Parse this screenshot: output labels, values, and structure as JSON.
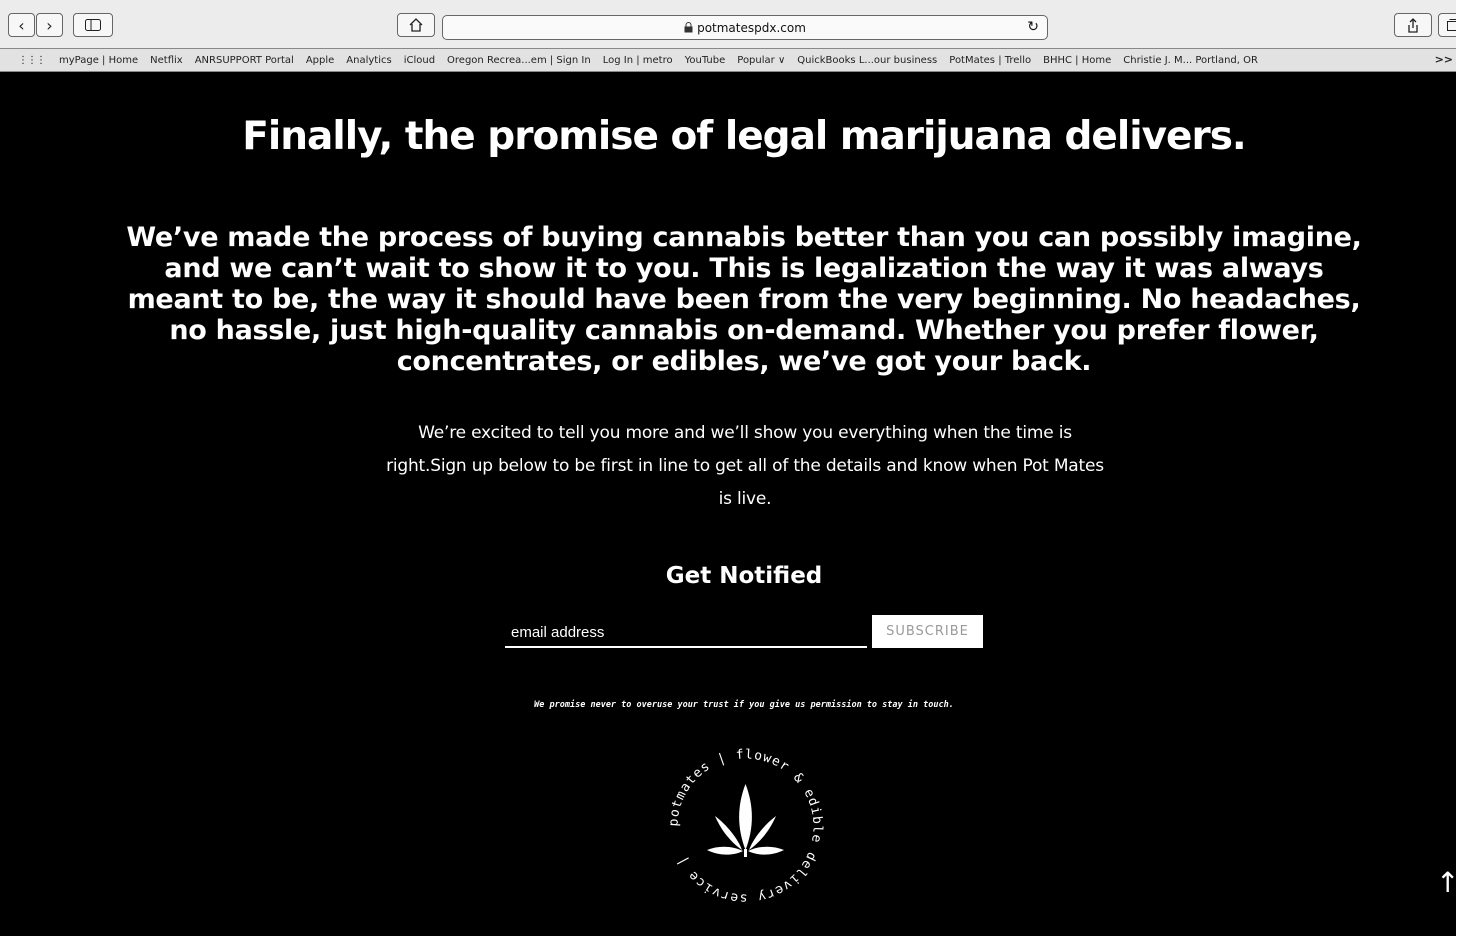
{
  "browser": {
    "url": "potmatespdx.com",
    "lock_icon": "lock-icon",
    "bookmarks": [
      "myPage | Home",
      "Netflix",
      "ANRSUPPORT Portal",
      "Apple",
      "Analytics",
      "iCloud",
      "Oregon Recrea...em | Sign In",
      "Log In | metro",
      "YouTube",
      "Popular ∨",
      "QuickBooks L...our business",
      "PotMates | Trello",
      "BHHC | Home",
      "Christie J. M... Portland, OR"
    ],
    "more_label": ">>"
  },
  "page": {
    "headline": "Finally, the promise of legal marijuana delivers.",
    "lead": "We’ve made the process of buying cannabis better than you can possibly imagine, and we can’t wait to show it to you. This is legalization the way it was always meant to be, the way it should have been from the very beginning. No headaches, no hassle, just high-quality cannabis on-demand. Whether you prefer flower, concentrates, or edibles, we’ve got your back.",
    "intro": "We’re excited to tell you more and we’ll show you everything when the time is right.Sign up below to be first in line to get all of the details and know when Pot Mates is live.",
    "notify_heading": "Get Notified",
    "email_placeholder": "email address",
    "subscribe_label": "SUBSCRIBE",
    "promise": "We promise never to overuse your trust if you give us permission to stay in touch.",
    "seal_text": "potmates | flower & edible delivery service |",
    "back_to_top": "↑"
  },
  "colors": {
    "background": "#000000",
    "text": "#ffffff",
    "chrome": "#ececec"
  }
}
